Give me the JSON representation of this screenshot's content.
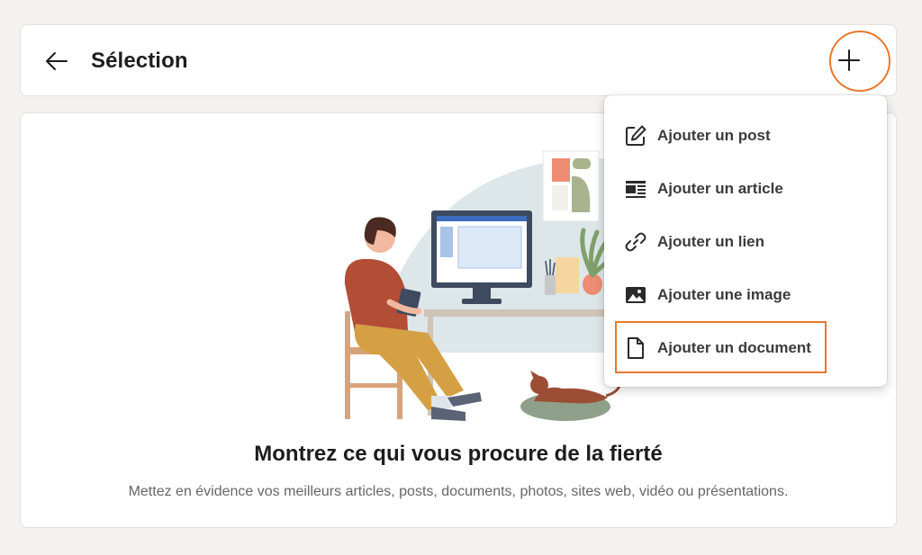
{
  "header": {
    "title": "Sélection",
    "back_icon": "arrow-left-icon",
    "add_icon": "plus-icon"
  },
  "empty_state": {
    "title": "Montrez ce qui vous procure de la fierté",
    "subtitle": "Mettez en évidence vos meilleurs articles, posts, documents, photos, sites web, vidéo ou présentations."
  },
  "menu": {
    "items": [
      {
        "label": "Ajouter un post",
        "icon": "edit-icon"
      },
      {
        "label": "Ajouter un article",
        "icon": "article-icon"
      },
      {
        "label": "Ajouter un lien",
        "icon": "link-icon"
      },
      {
        "label": "Ajouter une image",
        "icon": "image-icon"
      },
      {
        "label": "Ajouter un document",
        "icon": "document-icon"
      }
    ]
  },
  "colors": {
    "accent_highlight": "#e8782e",
    "background": "#f3f2ef"
  }
}
